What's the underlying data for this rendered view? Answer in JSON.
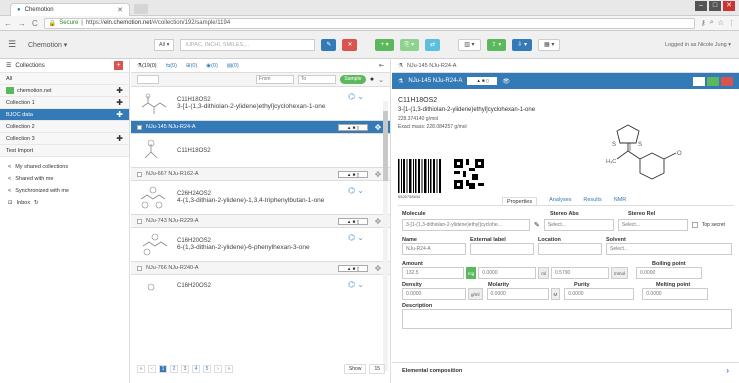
{
  "browser": {
    "tab_title": "Chemotion",
    "secure_label": "Secure",
    "url_scheme": "https://",
    "url_host": "eln.chemotion.net",
    "url_path": "/#/collection/192/sample/1194"
  },
  "appbar": {
    "brand": "Chemotion",
    "search_type": "All",
    "search_placeholder": "IUPAC, INCHI, SMILES,...",
    "login_text": "Logged in as Nicole Jung"
  },
  "sidebar": {
    "header": "Collections",
    "items": [
      {
        "label": "All",
        "active": false
      },
      {
        "label": "chemotion.net",
        "active": false
      },
      {
        "label": "Collection 1",
        "active": false
      },
      {
        "label": "BJOC data",
        "active": true
      },
      {
        "label": "Collection 2",
        "active": false
      },
      {
        "label": "Collection 3",
        "active": false
      },
      {
        "label": "Test Import",
        "active": false
      }
    ],
    "links": [
      "My shared collections",
      "Shared with me",
      "Synchronized with me",
      "Inbox"
    ]
  },
  "list": {
    "tabs": [
      "(19(0)",
      "(0)",
      "(0)",
      "(0)",
      "(0)"
    ],
    "from_label": "From",
    "to_label": "To",
    "switch_label": "Sample",
    "samples": [
      {
        "id": "",
        "formula": "C11H18OS2",
        "name": "3-[1-(1,3-dithiolan-2-ylidene)ethyl]cyclohexan-1-one",
        "active": false
      },
      {
        "id": "NJu-145 NJu-R24-A",
        "formula": "C11H18OS2",
        "name": "",
        "active": true
      },
      {
        "id": "NJu-667 NJu-R162-A",
        "formula": "C26H24OS2",
        "name": "4-(1,3-dithian-2-ylidene)-1,3,4-triphenylbutan-1-one",
        "active": false
      },
      {
        "id": "NJu-743 NJu-R229-A",
        "formula": "C16H20OS2",
        "name": "6-(1,3-dithian-2-ylidene)-6-phenylhexan-3-one",
        "active": false
      },
      {
        "id": "NJu-766 NJu-R240-A",
        "formula": "C16H20OS2",
        "name": "",
        "active": false
      }
    ],
    "pager": [
      "1",
      "2",
      "3",
      "4",
      "5",
      "›",
      "»"
    ],
    "show_label": "Show",
    "show_count": "15"
  },
  "detail": {
    "tab_label": "NJu-145 NJu-R24-A",
    "header_title": "NJu-145 NJu-R24-A",
    "formula": "C11H18OS2",
    "name": "3-[1-(1,3-dithiolan-2-ylidene)ethyl]cyclohexan-1-one",
    "mw": "228.374140 g/mol",
    "exact_mass": "Exact mass: 228.084257 g/mol",
    "barcode_number": "6526758634",
    "tabs": [
      "Properties",
      "Analyses",
      "Results",
      "NMR"
    ],
    "labels": {
      "molecule": "Molecule",
      "stereo_abs": "Stereo Abs",
      "stereo_rel": "Stereo Rel",
      "top_secret": "Top secret",
      "name": "Name",
      "external_label": "External label",
      "location": "Location",
      "solvent": "Solvent",
      "amount": "Amount",
      "boiling_point": "Boiling point",
      "density": "Density",
      "molarity": "Molarity",
      "purity": "Purity",
      "melting_point": "Melting point",
      "description": "Description",
      "elemental": "Elemental composition"
    },
    "values": {
      "molecule": "3-[1-(1,3-dithiolan-2-ylidene)ethyl]cyclohe...",
      "stereo_abs": "Select...",
      "stereo_rel": "Select...",
      "name": "NJu-R24-A",
      "solvent": "Select...",
      "amount": "132.5",
      "amount_unit": "mg",
      "amount2": "0.0000",
      "amount2_unit": "ml",
      "amount3": "0.5790",
      "amount3_unit": "mmol",
      "boiling": "0.0000",
      "density": "0.0000",
      "density_unit": "g/ml",
      "molarity": "0.0000",
      "molarity_unit": "M",
      "purity": "0.0000",
      "melting": "0.0000"
    }
  }
}
